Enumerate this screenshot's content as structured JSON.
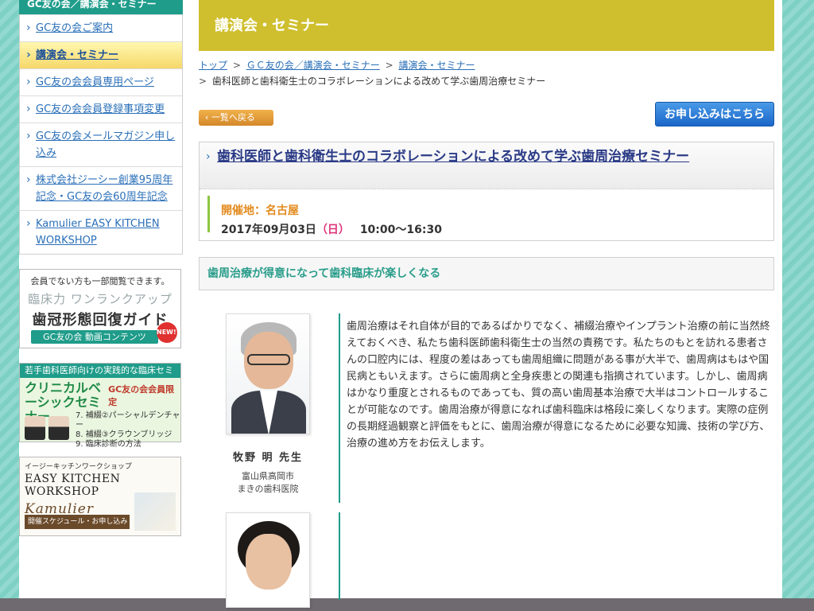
{
  "sidebar": {
    "heading": "GC友の会／講演会・セミナー",
    "items": [
      {
        "label": "GC友の会ご案内"
      },
      {
        "label": "講演会・セミナー"
      },
      {
        "label": "GC友の会会員専用ページ"
      },
      {
        "label": "GC友の会会員登録事項変更"
      },
      {
        "label": "GC友の会メールマガジン申し込み"
      },
      {
        "label": "株式会社ジーシー創業95周年記念・GC友の会60周年記念"
      },
      {
        "label": "Kamulier EASY KITCHEN WORKSHOP"
      }
    ],
    "banner1": {
      "note": "会員でない方も一部閲覧できます。",
      "line1": "臨床力 ワンランクアップ",
      "line2": "歯冠形態回復ガイド",
      "footer": "GC友の会 動画コンテンツ",
      "badge": "NEW!!"
    },
    "banner2": {
      "head": "若手歯科医師向けの実践的な臨床セミナー",
      "title": "クリニカルベーシックセミナー",
      "limited": "GC友の会会員限定",
      "list": [
        "7. 補綴②パーシャルデンチャー",
        "8. 補綴③クラウンブリッジ",
        "9. 臨床診断の方法"
      ]
    },
    "banner3": {
      "note": "イージーキッチンワークショップ",
      "title": "EASY KITCHEN WORKSHOP",
      "brand": "Kamulier",
      "footer": "開催スケジュール・お申し込み"
    }
  },
  "main": {
    "title": "講演会・セミナー",
    "breadcrumb": {
      "items": [
        "トップ",
        "ＧＣ友の会／講演会・セミナー",
        "講演会・セミナー"
      ],
      "current": "歯科医師と歯科衛生士のコラボレーションによる改めて学ぶ歯周治療セミナー"
    },
    "back_label": "一覧へ戻る",
    "apply_label": "お申し込みはこちら",
    "event": {
      "title": "歯科医師と歯科衛生士のコラボレーションによる改めて学ぶ歯周治療セミナー",
      "venue": "開催地：名古屋",
      "date": "2017年09月03日",
      "dow": "（日）",
      "time": "10:00〜16:30"
    },
    "subtitle": "歯周治療が得意になって歯科臨床が楽しくなる",
    "speaker1": {
      "name": "牧野 明 先生",
      "aff1": "富山県高岡市",
      "aff2": "まきの歯科医院",
      "text": "歯周治療はそれ自体が目的であるばかりでなく、補綴治療やインプラント治療の前に当然終えておくべき、私たち歯科医師歯科衛生士の当然の責務です。私たちのもとを訪れる患者さんの口腔内には、程度の差はあっても歯周組織に問題がある事が大半で、歯周病はもはや国民病ともいえます。さらに歯周病と全身疾患との関連も指摘されています。しかし、歯周病はかなり重度とされるものであっても、質の高い歯周基本治療で大半はコントロールすることが可能なのです。歯周治療が得意になれば歯科臨床は格段に楽しくなります。実際の症例の長期経過観察と評価をもとに、歯周治療が得意になるために必要な知識、技術の学び方、治療の進め方をお伝えします。"
    }
  }
}
